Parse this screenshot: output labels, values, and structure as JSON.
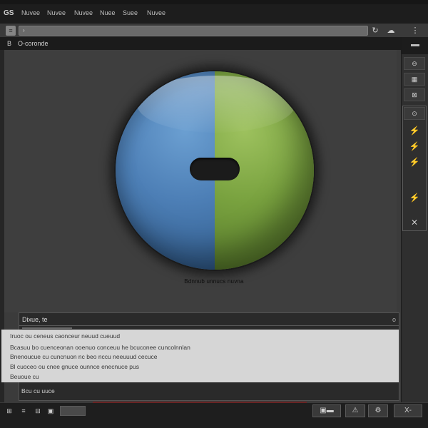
{
  "menubar": {
    "logo": "GS",
    "items": [
      "Nuvee",
      "Nuvee",
      "Nuvee",
      "Nuee",
      "Suee",
      "Nuvee"
    ]
  },
  "addressbar": {
    "left_button": "≡",
    "field_text": "›",
    "icons": [
      "refresh-icon",
      "share-icon",
      "more-icon"
    ],
    "icon_glyphs": [
      "↻",
      "☁",
      "⋮"
    ]
  },
  "panel": {
    "icon": "B",
    "title": "O-coronde"
  },
  "viewport": {
    "caption": "Bdnnub unnucs nuvna"
  },
  "subpanel": {
    "title": "Dixue, te",
    "rows": [
      "Iruoc ou ceneus caonceur neuud cueuud",
      "Bcasuu bo cuenceonan ooenuo conceuu he bcuconee cuncolnnlan",
      "Bnenoucue cu cuncnuon nc beo nccu neeuuud cecuce",
      "Bl cuoceo ou cnee gnuce ounnce enecnuce pus",
      "Beuoue cu"
    ],
    "footer": "Bcu cu  uuce",
    "left_marker": "o"
  },
  "right_column": {
    "buttons": [
      "⊖",
      "▦",
      "⊠",
      "⊙"
    ],
    "tools": [
      "⚡",
      "⚡",
      "⚡",
      "⚡",
      "⨯"
    ]
  },
  "statusbar": {
    "left_icons": [
      "⊞",
      "≡",
      "⊟",
      "▣"
    ],
    "right_buttons": [
      "▣▬",
      "⚠",
      "⚙",
      "X-"
    ]
  },
  "colors": {
    "sphere_left": "#4d7fb6",
    "sphere_right": "#79a23f",
    "background": "#3b3b3b"
  }
}
